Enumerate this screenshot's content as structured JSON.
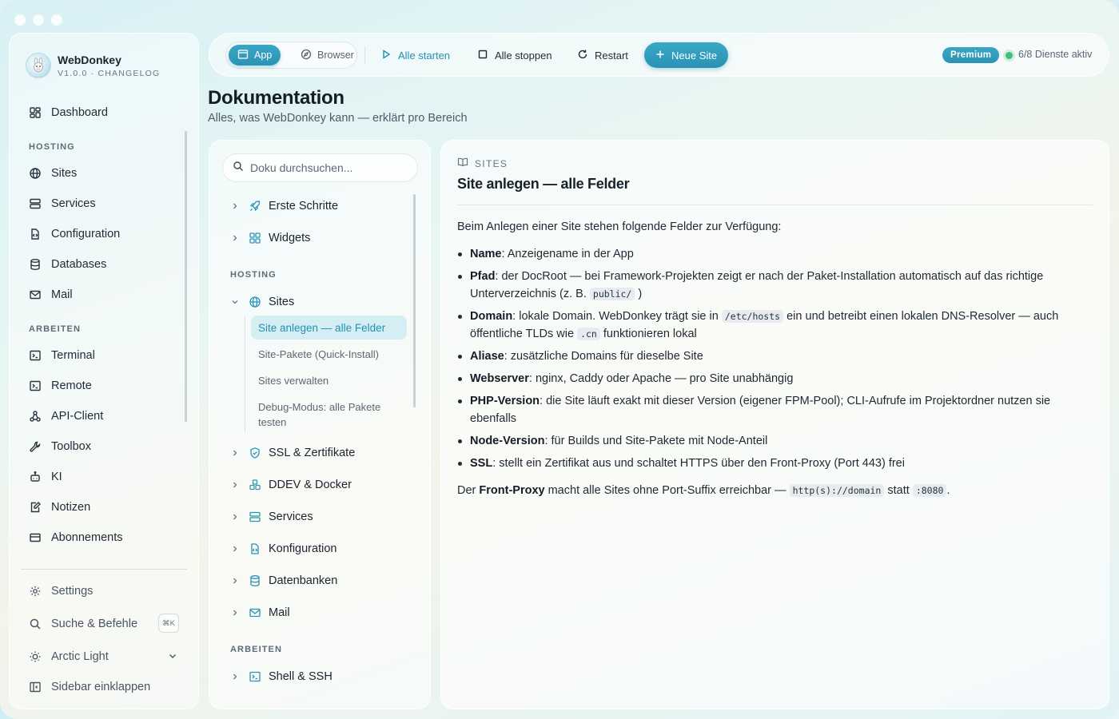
{
  "app": {
    "name": "WebDonkey",
    "version": "V1.0.0 · CHANGELOG"
  },
  "sidebar": {
    "top_item": "Dashboard",
    "hosting_label": "HOSTING",
    "hosting": [
      "Sites",
      "Services",
      "Configuration",
      "Databases",
      "Mail"
    ],
    "arbeiten_label": "ARBEITEN",
    "arbeiten": [
      "Terminal",
      "Remote",
      "API-Client",
      "Toolbox",
      "KI",
      "Notizen",
      "Abonnements"
    ],
    "settings": "Settings",
    "search": "Suche & Befehle",
    "search_shortcut": "⌘K",
    "theme": "Arctic Light",
    "collapse": "Sidebar einklappen"
  },
  "toolbar": {
    "mode_app": "App",
    "mode_browser": "Browser",
    "start_all": "Alle starten",
    "stop_all": "Alle stoppen",
    "restart": "Restart",
    "new_site": "Neue Site",
    "premium": "Premium",
    "services_status": "6/8 Dienste aktiv",
    "status_color": "#3cc07a",
    "accent_color": "#2b93b5"
  },
  "page": {
    "title": "Dokumentation",
    "subtitle": "Alles, was WebDonkey kann — erklärt pro Bereich"
  },
  "docnav": {
    "search_placeholder": "Doku durchsuchen...",
    "top": [
      "Erste Schritte",
      "Widgets"
    ],
    "hosting_label": "HOSTING",
    "sites": "Sites",
    "sites_children": [
      "Site anlegen — alle Felder",
      "Site-Pakete (Quick-Install)",
      "Sites verwalten",
      "Debug-Modus: alle Pakete testen"
    ],
    "hosting_rest": [
      "SSL & Zertifikate",
      "DDEV & Docker",
      "Services",
      "Konfiguration",
      "Datenbanken",
      "Mail"
    ],
    "arbeiten_label": "ARBEITEN",
    "arbeiten": [
      "Shell & SSH"
    ]
  },
  "content": {
    "crumb": "SITES",
    "title": "Site anlegen — alle Felder",
    "intro": "Beim Anlegen einer Site stehen folgende Felder zur Verfügung:",
    "fields": [
      {
        "name": "Name",
        "text": ": Anzeigename in der App"
      },
      {
        "name": "Pfad",
        "text": ": der DocRoot — bei Framework-Projekten zeigt er nach der Paket-Installation automatisch auf das richtige Unterverzeichnis (z. B. ",
        "code": "public/",
        "after": ")"
      },
      {
        "name": "Domain",
        "text": ": lokale Domain. WebDonkey trägt sie in ",
        "code": "/etc/hosts",
        "mid": " ein und betreibt einen lokalen DNS-Resolver — auch öffentliche TLDs wie ",
        "code2": ".cn",
        "after": " funktionieren lokal"
      },
      {
        "name": "Aliase",
        "text": ": zusätzliche Domains für dieselbe Site"
      },
      {
        "name": "Webserver",
        "text": ": nginx, Caddy oder Apache — pro Site unabhängig"
      },
      {
        "name": "PHP-Version",
        "text": ": die Site läuft exakt mit dieser Version (eigener FPM-Pool); CLI-Aufrufe im Projektordner nutzen sie ebenfalls"
      },
      {
        "name": "Node-Version",
        "text": ": für Builds und Site-Pakete mit Node-Anteil"
      },
      {
        "name": "SSL",
        "text": ": stellt ein Zertifikat aus und schaltet HTTPS über den Front-Proxy (Port 443) frei"
      }
    ],
    "outro_pre": "Der ",
    "outro_bold": "Front-Proxy",
    "outro_mid": " macht alle Sites ohne Port-Suffix erreichbar — ",
    "outro_code1": "http(s)://domain",
    "outro_statt": " statt ",
    "outro_code2": ":8080",
    "outro_end": "."
  }
}
